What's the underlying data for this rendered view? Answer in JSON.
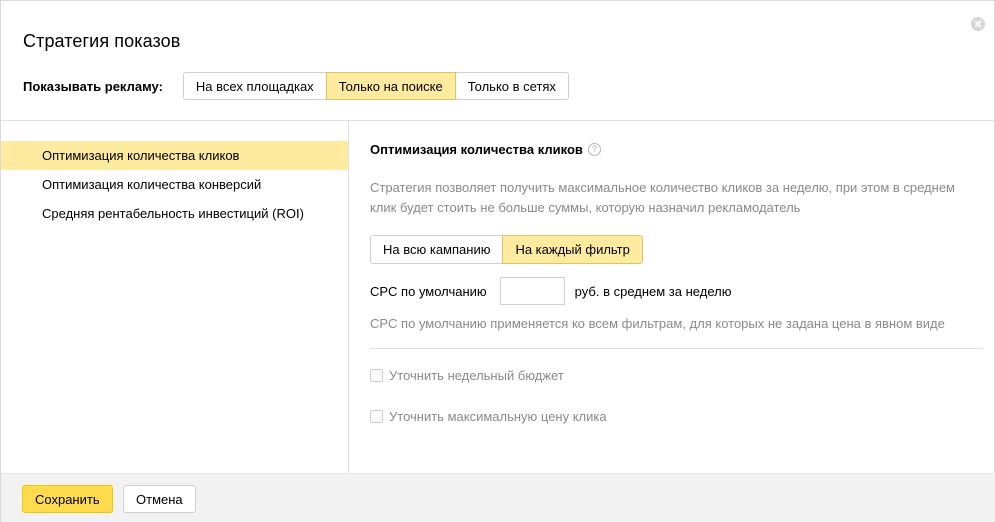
{
  "dialog": {
    "title": "Стратегия показов"
  },
  "show_ads": {
    "label": "Показывать рекламу:",
    "options": [
      "На всех площадках",
      "Только на поиске",
      "Только в сетях"
    ],
    "selected": "Только на поиске"
  },
  "strategies": {
    "items": [
      "Оптимизация количества кликов",
      "Оптимизация количества конверсий",
      "Средняя рентабельность инвестиций (ROI)"
    ],
    "selected": "Оптимизация количества кликов"
  },
  "details": {
    "heading": "Оптимизация количества кликов",
    "help_icon": "question-circle-icon",
    "description": "Стратегия позволяет получить максимальное количество кликов за неделю, при этом в среднем клик будет стоить не больше суммы, которую назначил рекламодатель",
    "scope_options": [
      "На всю кампанию",
      "На каждый фильтр"
    ],
    "scope_selected": "На каждый фильтр",
    "cpc_label": "CPC по умолчанию",
    "cpc_value": "",
    "cpc_unit": "руб. в среднем за неделю",
    "cpc_hint": "CPC по умолчанию применяется ко всем фильтрам, для которых не задана цена в явном виде",
    "checkbox_budget": "Уточнить недельный бюджет",
    "checkbox_max_price": "Уточнить максимальную цену клика"
  },
  "footer": {
    "save_label": "Сохранить",
    "cancel_label": "Отмена"
  },
  "colors": {
    "accent_yellow": "#ffdb4d",
    "selected_bg": "#ffeba0",
    "muted_text": "#8a8a8a"
  }
}
